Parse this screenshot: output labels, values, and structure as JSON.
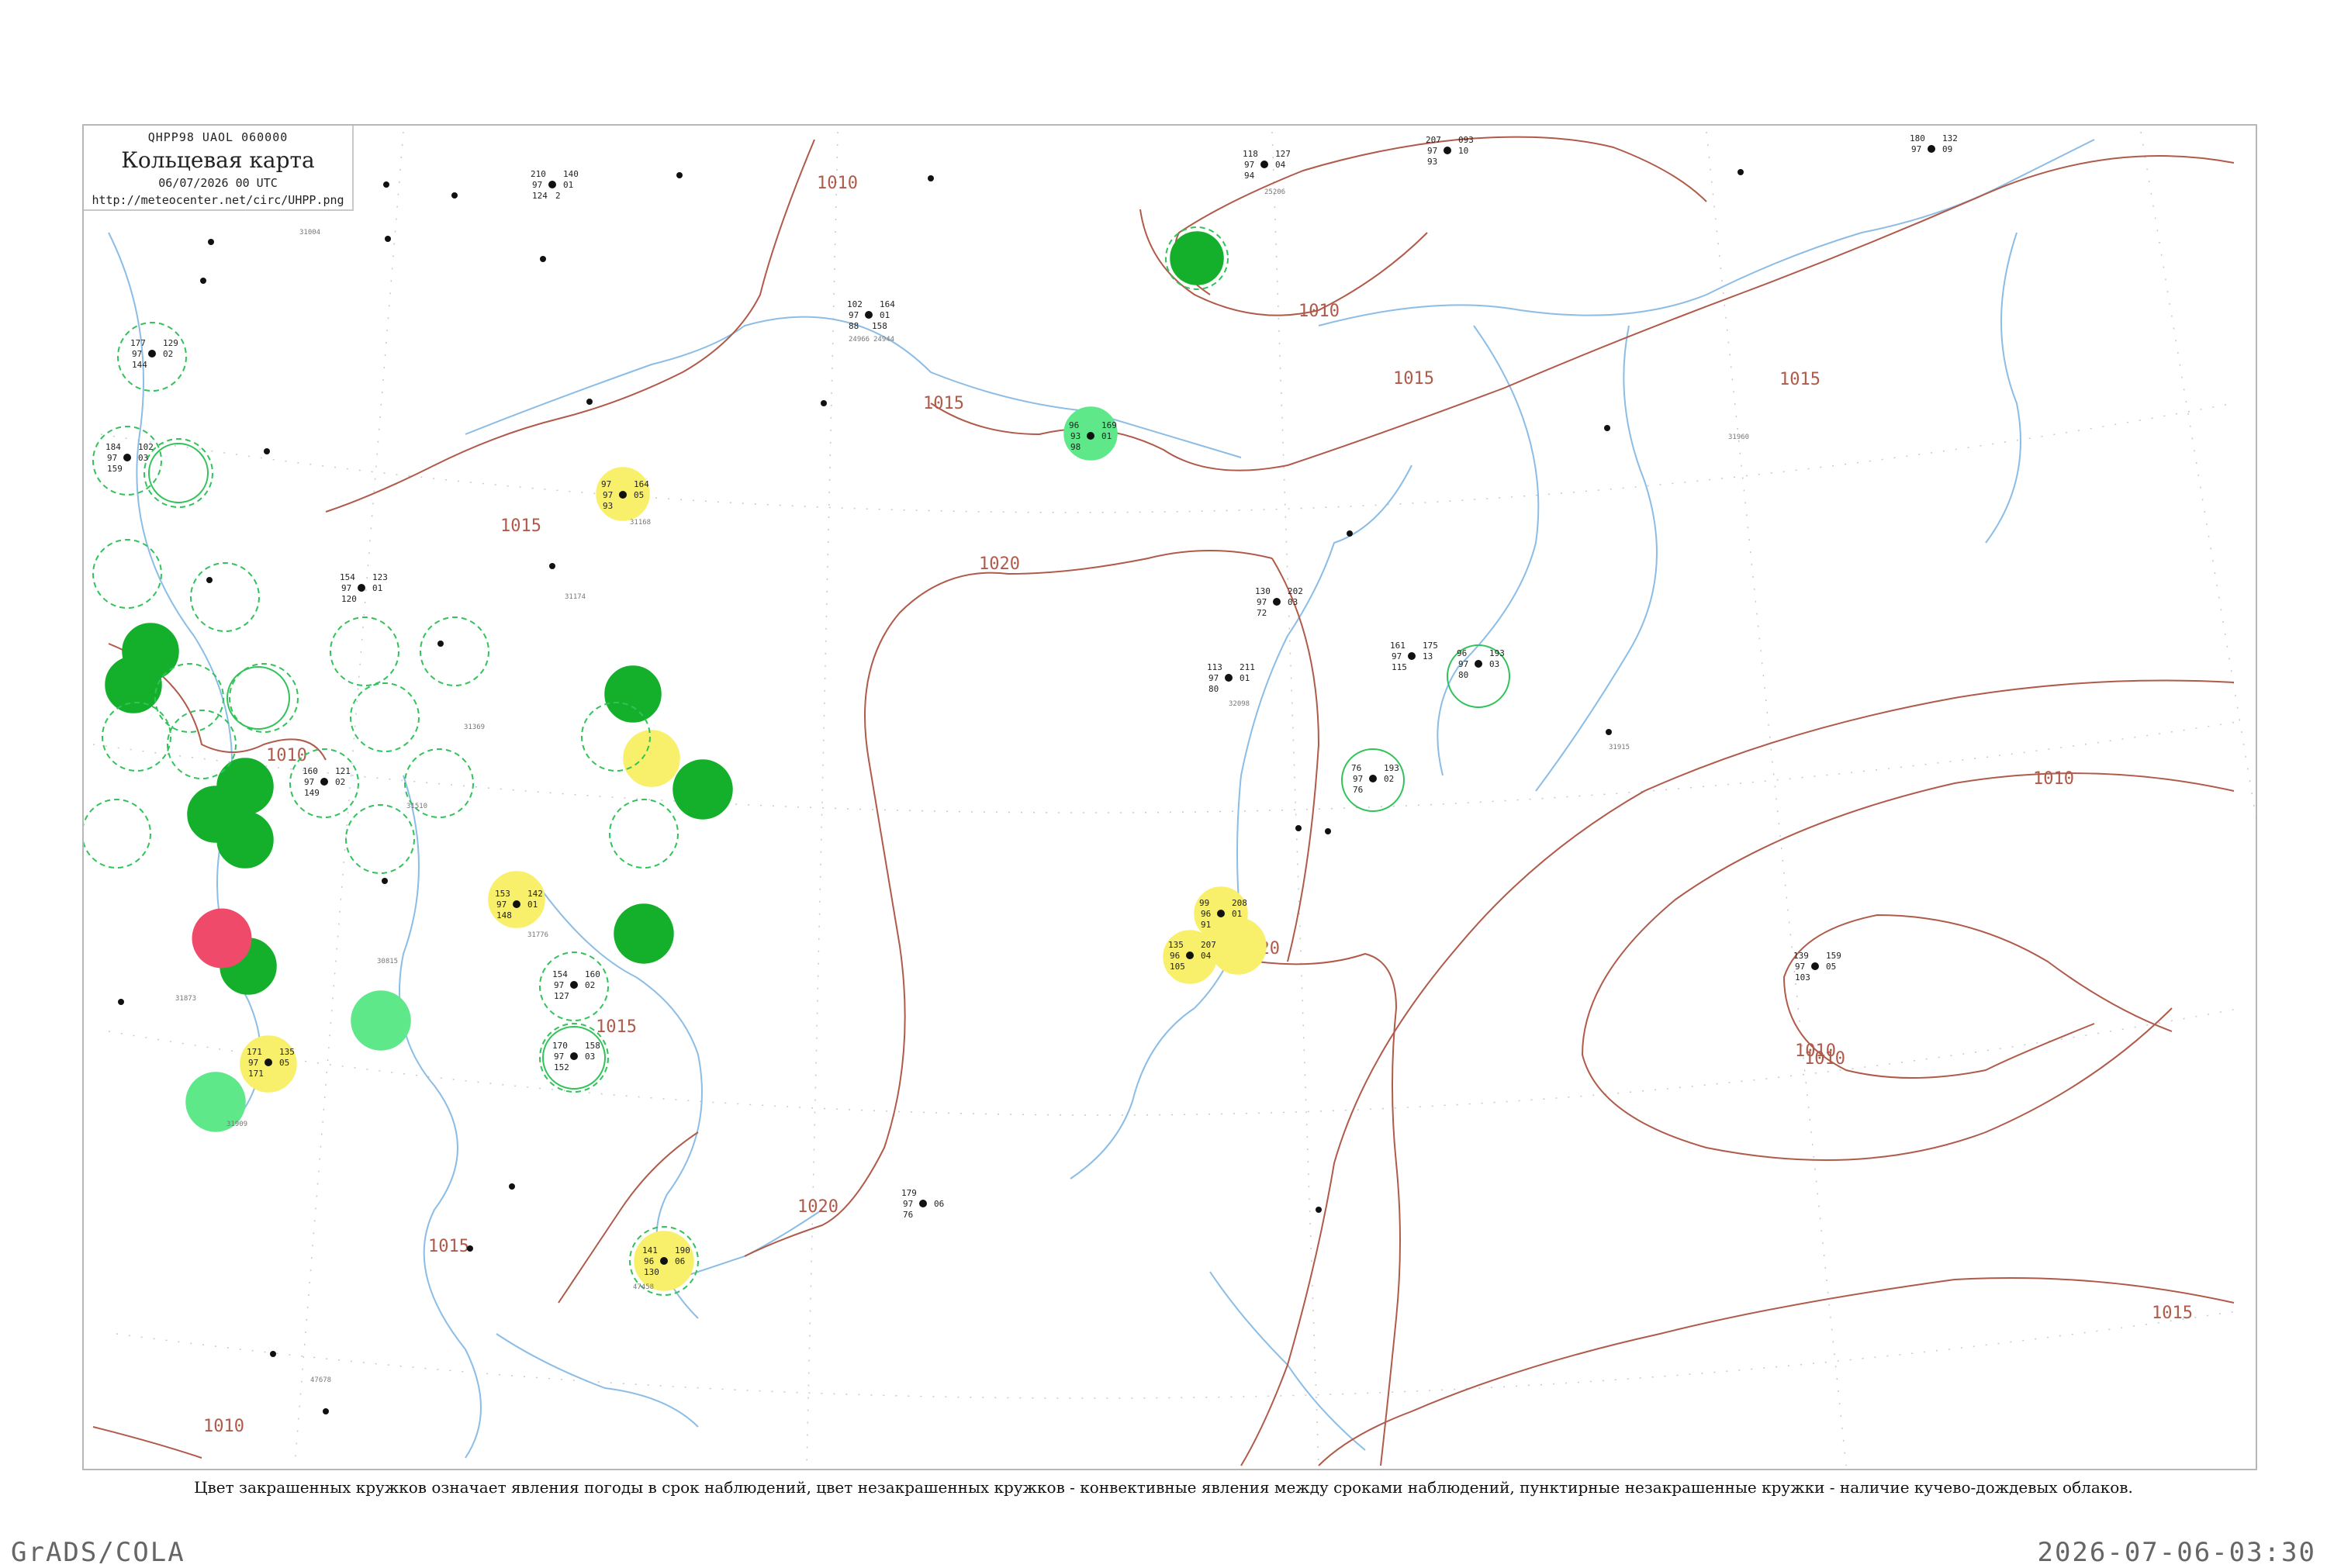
{
  "info": {
    "code": "QHPP98  UAOL  060000",
    "title": "Кольцевая карта",
    "date": "06/07/2026 00 UTC",
    "url": "http://meteocenter.net/circ/UHPP.png"
  },
  "caption": "Цвет закрашенных кружков означает явления погоды в срок наблюдений, цвет незакрашенных кружков - конвективные явления между сроками наблюдений, пунктирные незакрашенные кружки - наличие кучево-дождевых облаков.",
  "footer": {
    "left": "GrADS/COLA",
    "right": "2026-07-06-03:30"
  },
  "colors": {
    "coast": "#8bbde6",
    "isobar": "#b05a4a",
    "graticule": "#c9c9c9",
    "green_dark": "#14b02c",
    "green_light": "#5fe88a",
    "yellow": "#f8f06a",
    "red": "#f04a6a",
    "dashed_ring": "#32c25a"
  },
  "isobar_labels": [
    {
      "text": "1010"
    },
    {
      "text": "1010"
    },
    {
      "text": "1015"
    },
    {
      "text": "1015"
    },
    {
      "text": "1015"
    },
    {
      "text": "1015"
    },
    {
      "text": "1020"
    },
    {
      "text": "1010"
    },
    {
      "text": "1010"
    },
    {
      "text": "1015"
    },
    {
      "text": "1020"
    },
    {
      "text": "1020"
    },
    {
      "text": "1010"
    },
    {
      "text": "1015"
    },
    {
      "text": "1015"
    },
    {
      "text": "1010"
    },
    {
      "text": "1010"
    }
  ],
  "station_labels": {
    "s1": [
      "210",
      "140",
      "97",
      "01",
      "124",
      "2"
    ],
    "s2": [
      "102",
      "164",
      "97",
      "01",
      "88",
      "158"
    ],
    "s3": [
      "118",
      "127",
      "97",
      "04",
      "94"
    ],
    "s4": [
      "207",
      "093",
      "97",
      "10",
      "93"
    ],
    "s5": [
      "180",
      "132",
      "97",
      "09"
    ],
    "s6": [
      "97",
      "164",
      "97",
      "05",
      "93"
    ],
    "s7": [
      "96",
      "169",
      "93",
      "01",
      "98"
    ],
    "s8": [
      "130",
      "202",
      "97",
      "03",
      "72"
    ],
    "s9": [
      "113",
      "211",
      "97",
      "01",
      "80"
    ],
    "s10": [
      "161",
      "175",
      "97",
      "13",
      "115"
    ],
    "s11": [
      "96",
      "193",
      "97",
      "03",
      "80"
    ],
    "s12": [
      "76",
      "193",
      "97",
      "02",
      "76"
    ],
    "s13": [
      "99",
      "208",
      "96",
      "01",
      "91"
    ],
    "s14": [
      "135",
      "207",
      "96",
      "04",
      "105"
    ],
    "s15": [
      "139",
      "159",
      "97",
      "05",
      "103"
    ],
    "s16": [
      "141",
      "190",
      "96",
      "06",
      "130"
    ],
    "s17": [
      "179",
      "97",
      "06",
      "76"
    ],
    "s18": [
      "177",
      "129",
      "97",
      "02",
      "144"
    ],
    "s19": [
      "184",
      "102",
      "97",
      "03",
      "159"
    ],
    "s20": [
      "160",
      "121",
      "97",
      "02",
      "149"
    ],
    "s21": [
      "153",
      "142",
      "97",
      "01",
      "148"
    ],
    "s22": [
      "154",
      "160",
      "97",
      "02",
      "127"
    ],
    "s23": [
      "170",
      "158",
      "97",
      "03",
      "152"
    ],
    "s24": [
      "171",
      "135",
      "97",
      "05",
      "171"
    ],
    "s25": [
      "154",
      "123",
      "97",
      "01",
      "120"
    ]
  },
  "station_ids": [
    "31168",
    "24966",
    "31004",
    "31174",
    "31369",
    "31510",
    "31776",
    "31873",
    "31909",
    "32098",
    "30815",
    "47458",
    "47678",
    "24944",
    "25206",
    "31915",
    "31960"
  ]
}
